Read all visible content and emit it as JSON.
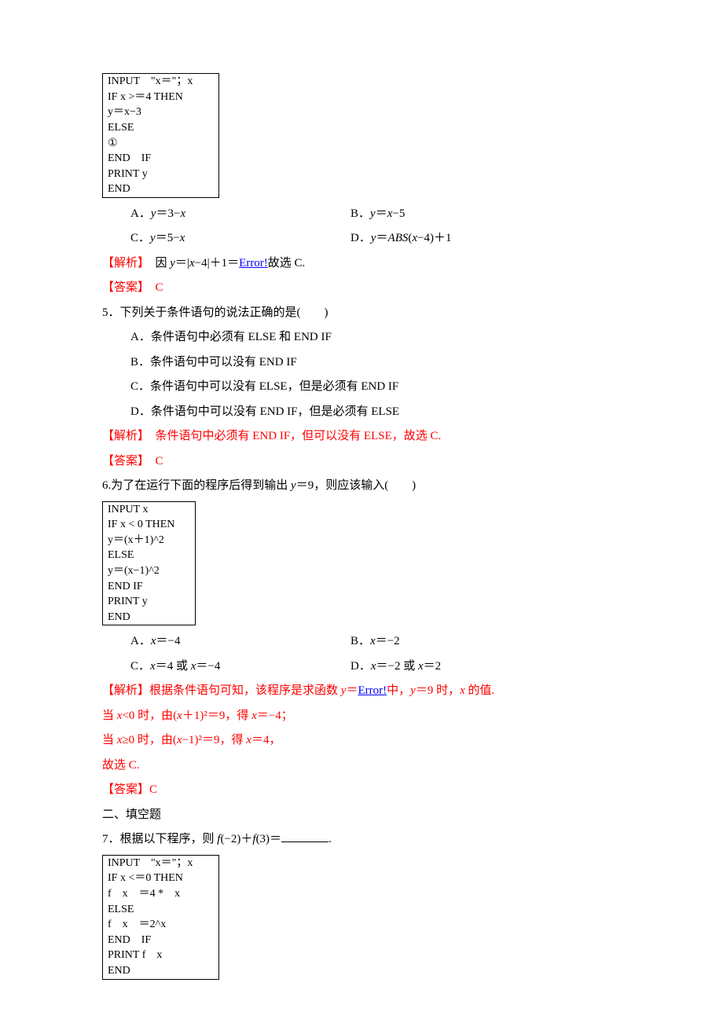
{
  "q4": {
    "code": {
      "l1": "INPUT　\"x＝\"；x",
      "l2": "IF x >＝4 THEN",
      "l3": "y＝x−3",
      "l4": "ELSE",
      "l5": "①",
      "l6": "END　IF",
      "l7": "PRINT y",
      "l8": "END"
    },
    "choiceA_pre": "A．",
    "choiceA_y": "y",
    "choiceA_eq": "＝3−",
    "choiceA_x": "x",
    "choiceB_pre": "B．",
    "choiceB_y": "y",
    "choiceB_eq": "＝",
    "choiceB_x": "x",
    "choiceB_tail": "−5",
    "choiceC_pre": "C．",
    "choiceC_y": "y",
    "choiceC_eq": "＝5−",
    "choiceC_x": "x",
    "choiceD_pre": "D．",
    "choiceD_y": "y",
    "choiceD_eq": "＝",
    "choiceD_abs": "ABS",
    "choiceD_paren": "(",
    "choiceD_x": "x",
    "choiceD_tail": "−4)＋1",
    "expl_label": "【解析】",
    "expl_pre": "　因 ",
    "expl_y": "y",
    "expl_mid": "＝|",
    "expl_x": "x",
    "expl_mid2": "−4|＋1＝",
    "expl_err": "Error!",
    "expl_tail": "故选 C.",
    "ans_label": "【答案】",
    "ans_val": "　C"
  },
  "q5": {
    "num": "5．下列关于条件语句的说法正确的是(　　)",
    "A": "A．条件语句中必须有 ELSE 和 END IF",
    "B": "B．条件语句中可以没有 END IF",
    "C": "C．条件语句中可以没有 ELSE，但是必须有 END IF",
    "D": "D．条件语句中可以没有 END IF，但是必须有 ELSE",
    "expl_label": "【解析】",
    "expl": "　条件语句中必须有 END IF，但可以没有 ELSE，故选 C.",
    "ans_label": "【答案】",
    "ans_val": "　C"
  },
  "q6": {
    "num_pre": "6.为了在运行下面的程序后得到输出 ",
    "num_y": "y",
    "num_mid": "＝9，则应该输入(　　)",
    "code": {
      "l1": "INPUT  x",
      "l2": "IF x < 0 THEN",
      "l3": "y＝(x＋1)^2",
      "l4": "ELSE",
      "l5": "y＝(x−1)^2",
      "l6": "END IF",
      "l7": "PRINT y",
      "l8": "END"
    },
    "A_pre": "A．",
    "A_x": "x",
    "A_tail": "＝−4",
    "B_pre": "B．",
    "B_x": "x",
    "B_tail": "＝−2",
    "C_pre": "C．",
    "C_x": "x",
    "C_mid": "＝4 或 ",
    "C_x2": "x",
    "C_tail": "＝−4",
    "D_pre": "D．",
    "D_x": "x",
    "D_mid": "＝−2 或 ",
    "D_x2": "x",
    "D_tail": "＝2",
    "expl_label": "【解析】",
    "expl_p1_a": "根据条件语句可知，该程序是求函数 ",
    "expl_p1_y": "y",
    "expl_p1_b": "＝",
    "expl_err": "Error!",
    "expl_p1_c": "中，",
    "expl_p1_y2": "y",
    "expl_p1_d": "＝9 时，",
    "expl_p1_x": "x",
    "expl_p1_e": " 的值.",
    "expl_p2_a": "当 ",
    "expl_p2_x": "x",
    "expl_p2_b": "<0 时，由(",
    "expl_p2_x2": "x",
    "expl_p2_c": "＋1)²＝9，得 ",
    "expl_p2_x3": "x",
    "expl_p2_d": "＝−4；",
    "expl_p3_a": "当 ",
    "expl_p3_x": "x",
    "expl_p3_b": "≥0 时，由(",
    "expl_p3_x2": "x",
    "expl_p3_c": "−1)²＝9，得 ",
    "expl_p3_x3": "x",
    "expl_p3_d": "＝4，",
    "expl_p4": "故选 C.",
    "ans_label": "【答案】",
    "ans_val": "C"
  },
  "section2": "二、填空题",
  "q7": {
    "num_pre": "7．根据以下程序，则 ",
    "f": "f",
    "num_mid1": "(−2)＋",
    "f2": "f",
    "num_mid2": "(3)＝",
    "num_tail": ".",
    "code": {
      "l1": "INPUT　\"x＝\"；x",
      "l2": "IF x <＝0 THEN",
      "l3": "f　x　＝4 *　x",
      "l4": "ELSE",
      "l5": "f　x　＝2^x",
      "l6": "END　IF",
      "l7": "PRINT f　x",
      "l8": "END"
    }
  }
}
